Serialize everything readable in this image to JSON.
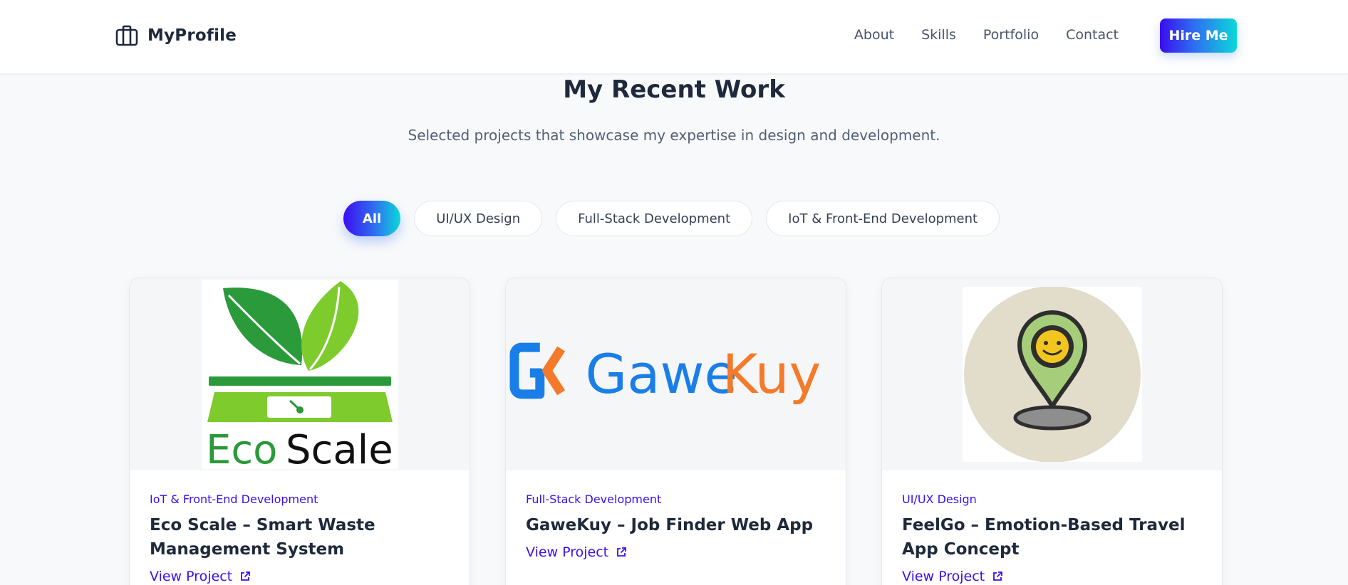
{
  "header": {
    "brand": "MyProfile",
    "brand_icon": "briefcase-icon",
    "nav": [
      "About",
      "Skills",
      "Portfolio",
      "Contact"
    ],
    "cta": "Hire Me"
  },
  "section": {
    "title": "My Recent Work",
    "subtitle": "Selected projects that showcase my expertise in design and development."
  },
  "filters": [
    {
      "label": "All",
      "active": true
    },
    {
      "label": "UI/UX Design",
      "active": false
    },
    {
      "label": "Full-Stack Development",
      "active": false
    },
    {
      "label": "IoT & Front-End Development",
      "active": false
    }
  ],
  "projects": [
    {
      "category": "IoT & Front-End Development",
      "title": "Eco Scale – Smart Waste Management System",
      "link": "View Project",
      "logo": {
        "eco": "Eco",
        "scale": "Scale"
      }
    },
    {
      "category": "Full-Stack Development",
      "title": "GaweKuy – Job Finder Web App",
      "link": "View Project",
      "logo": {
        "gawe": "Gawe",
        "kuy": "Kuy"
      }
    },
    {
      "category": "UI/UX Design",
      "title": "FeelGo – Emotion-Based Travel App Concept",
      "link": "View Project"
    }
  ],
  "colors": {
    "accent": "#3b0df0",
    "gradient_start": "#3b0df0",
    "gradient_end": "#0bd8d8",
    "text_dark": "#1e293b",
    "text_muted": "#526077",
    "eco_green": "#2a9a3a",
    "eco_lime": "#7ecb2d",
    "gawe_blue": "#1a7ee8",
    "kuy_orange": "#f47a2a"
  }
}
